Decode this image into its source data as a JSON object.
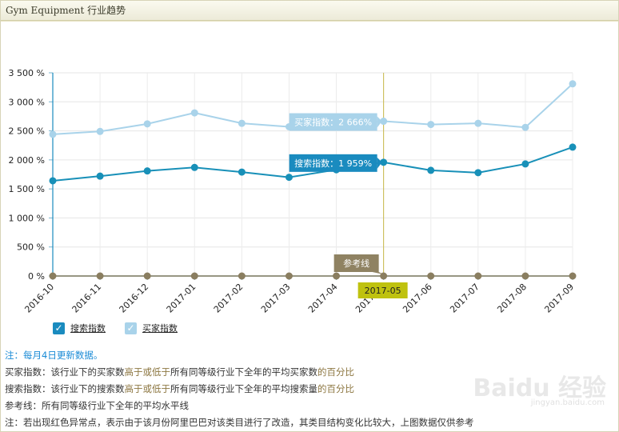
{
  "header": {
    "title": "Gym Equipment 行业趋势"
  },
  "chart_data": {
    "type": "line",
    "categories": [
      "2016-10",
      "2016-11",
      "2016-12",
      "2017-01",
      "2017-02",
      "2017-03",
      "2017-04",
      "2017-05",
      "2017-06",
      "2017-07",
      "2017-08",
      "2017-09"
    ],
    "y_ticks": [
      "0 %",
      "500 %",
      "1 000 %",
      "1 500 %",
      "2 000 %",
      "2 500 %",
      "3 000 %",
      "3 500 %"
    ],
    "ylim": [
      0,
      3500
    ],
    "grid": true,
    "series": [
      {
        "name": "买家指数",
        "color": "#a9d3ea",
        "values": [
          2440,
          2490,
          2620,
          2810,
          2630,
          2570,
          2590,
          2666,
          2610,
          2630,
          2560,
          3310
        ]
      },
      {
        "name": "搜索指数",
        "color": "#1890b8",
        "values": [
          1640,
          1720,
          1810,
          1870,
          1790,
          1700,
          1830,
          1959,
          1820,
          1780,
          1930,
          2220
        ]
      },
      {
        "name": "参考线",
        "color": "#8a7e60",
        "values": [
          0,
          0,
          0,
          0,
          0,
          0,
          0,
          0,
          0,
          0,
          0,
          0
        ]
      }
    ],
    "highlight_category": "2017-05",
    "tooltips": [
      {
        "series": "买家指数",
        "text": "买家指数：2 666%"
      },
      {
        "series": "搜索指数",
        "text": "搜索指数：1 959%"
      },
      {
        "series": "参考线",
        "text": "参考线"
      }
    ]
  },
  "legend": [
    {
      "label": "搜索指数",
      "color": "#1a8bbf",
      "checked": true
    },
    {
      "label": "买家指数",
      "color": "#a9d3ea",
      "checked": true
    }
  ],
  "notes": {
    "update": "注：每月4日更新数据。",
    "buyer": {
      "pre": "买家指数：该行业下的买家数",
      "hl1": "高于或低于",
      "mid": "所有同等级行业下全年的平均买家数",
      "hl2": "的百分比"
    },
    "search": {
      "pre": "搜索指数：该行业下的搜索数",
      "hl1": "高于或低于",
      "mid": "所有同等级行业下全年的平均搜索量",
      "hl2": "的百分比"
    },
    "ref": "参考线：所有同等级行业下全年的平均水平线",
    "anomaly": "注：若出现红色异常点，表示由于该月份阿里巴巴对该类目进行了改造，其类目结构变化比较大，上图数据仅供参考"
  },
  "watermark": {
    "brand": "Baidu 经验",
    "url": "jingyan.baidu.com"
  }
}
